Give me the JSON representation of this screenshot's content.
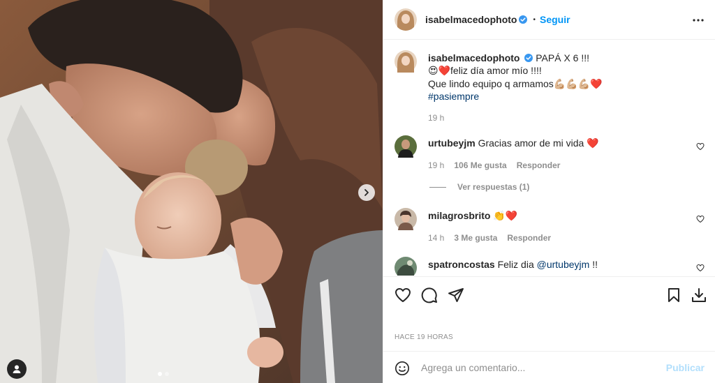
{
  "post": {
    "author": "isabelmacedophoto",
    "follow_label": "Seguir",
    "separator": "•"
  },
  "caption": {
    "author": "isabelmacedophoto",
    "line1": "PAPÁ X 6 !!!",
    "line2": "😍❤️feliz día amor mío !!!!",
    "line3": "Que lindo equipo q armamos💪🏼💪🏼💪🏼❤️",
    "hashtag": "#pasiempre",
    "time": "19 h"
  },
  "comments": [
    {
      "user": "urtubeyjm",
      "text": "Gracias amor de mi vida ❤️",
      "time": "19 h",
      "likes": "106 Me gusta",
      "reply": "Responder",
      "view_replies": "Ver respuestas (1)"
    },
    {
      "user": "milagrosbrito",
      "text": "👏❤️",
      "time": "14 h",
      "likes": "3 Me gusta",
      "reply": "Responder"
    },
    {
      "user": "spatroncostas",
      "text_before": "Feliz dia ",
      "mention": "@urtubeyjm",
      "text_after": " !!"
    }
  ],
  "footer": {
    "timestamp": "HACE 19 HORAS",
    "comment_placeholder": "Agrega un comentario...",
    "publish_label": "Publicar"
  },
  "icons": {
    "verified": "verified-badge-icon",
    "more": "more-options-icon",
    "like": "heart-icon",
    "comment": "comment-icon",
    "share": "send-icon",
    "save": "bookmark-icon",
    "download": "download-icon",
    "emoji": "emoji-icon",
    "next": "chevron-right-icon",
    "tag": "user-tag-icon"
  },
  "colors": {
    "accent": "#0095f6",
    "link": "#00376b",
    "verified": "#3897f0",
    "muted": "#8e8e8e",
    "publish_disabled": "#b2dffc"
  }
}
